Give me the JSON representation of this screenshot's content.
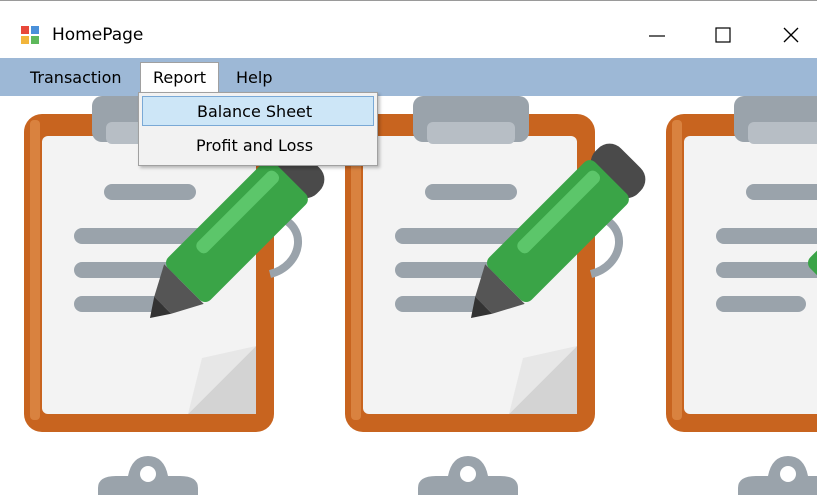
{
  "window": {
    "title": "HomePage",
    "icons": {
      "app": "app-icon",
      "minimize": "minimize-icon",
      "maximize": "maximize-icon",
      "close": "close-icon"
    }
  },
  "menubar": {
    "items": [
      {
        "label": "Transaction"
      },
      {
        "label": "Report",
        "open": true
      },
      {
        "label": "Help"
      }
    ]
  },
  "report_menu": {
    "items": [
      {
        "label": "Balance Sheet",
        "highlighted": true
      },
      {
        "label": "Profit and Loss"
      }
    ]
  },
  "background": {
    "image": "clipboard-with-pen pattern"
  },
  "colors": {
    "menubar": "#9db8d6",
    "highlight": "#cde6f7",
    "clipboard": "#c8641f",
    "pen": "#3aa447"
  }
}
